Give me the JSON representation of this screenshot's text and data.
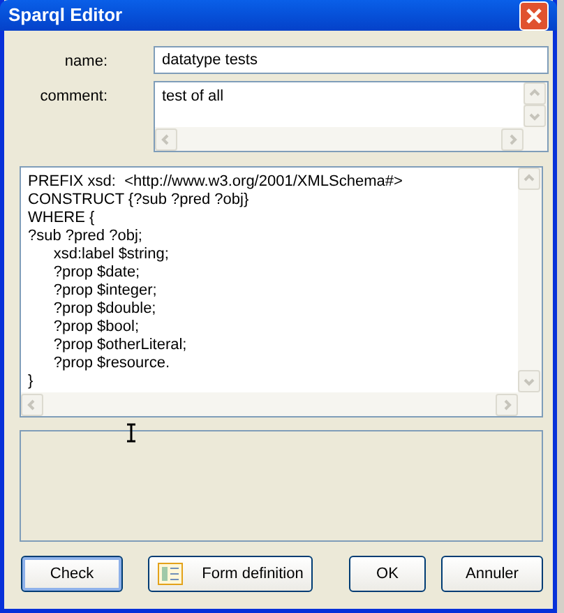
{
  "window": {
    "title": "Sparql Editor"
  },
  "fields": [
    {
      "label": "name:",
      "value": "datatype tests",
      "kind": "line"
    },
    {
      "label": "comment:",
      "value": "test of all",
      "kind": "area"
    }
  ],
  "query": "PREFIX xsd:  <http://www.w3.org/2001/XMLSchema#>\nCONSTRUCT {?sub ?pred ?obj}\nWHERE {\n?sub ?pred ?obj;\n\txsd:label $string;\n\t?prop $date;\n\t?prop $integer;\n\t?prop $double;\n\t?prop $bool;\n\t?prop $otherLiteral;\n\t?prop $resource.\n}",
  "buttons": [
    {
      "label": "Check",
      "kind": "plain",
      "focused": true
    },
    {
      "label": "Form definition",
      "kind": "icon",
      "focused": false
    },
    {
      "label": "OK",
      "kind": "plain",
      "focused": false
    },
    {
      "label": "Annuler",
      "kind": "plain",
      "focused": false
    }
  ]
}
